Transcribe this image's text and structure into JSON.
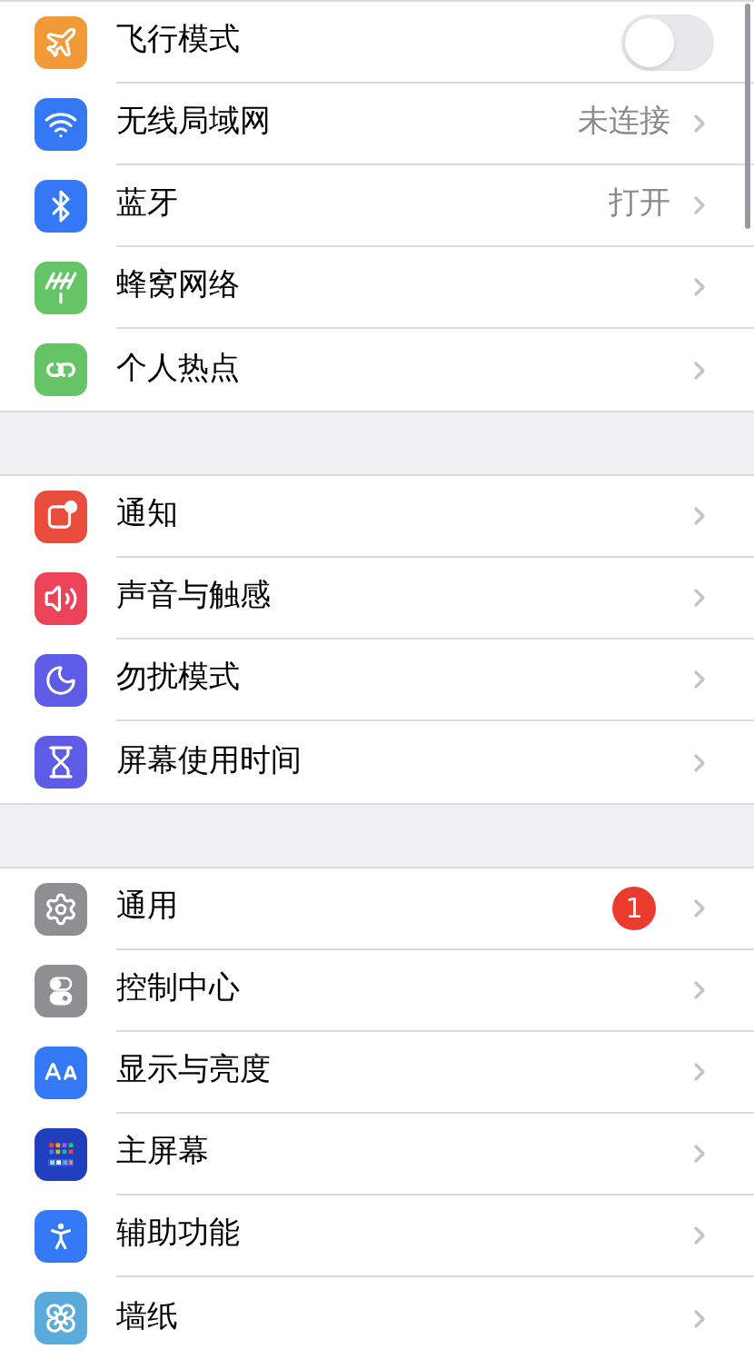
{
  "groups": [
    {
      "items": [
        {
          "label": "飞行模式",
          "kind": "toggle",
          "on": false
        },
        {
          "label": "无线局域网",
          "kind": "link",
          "value": "未连接"
        },
        {
          "label": "蓝牙",
          "kind": "link",
          "value": "打开"
        },
        {
          "label": "蜂窝网络",
          "kind": "link"
        },
        {
          "label": "个人热点",
          "kind": "link"
        }
      ]
    },
    {
      "items": [
        {
          "label": "通知",
          "kind": "link"
        },
        {
          "label": "声音与触感",
          "kind": "link"
        },
        {
          "label": "勿扰模式",
          "kind": "link"
        },
        {
          "label": "屏幕使用时间",
          "kind": "link"
        }
      ]
    },
    {
      "items": [
        {
          "label": "通用",
          "kind": "link",
          "badge": "1"
        },
        {
          "label": "控制中心",
          "kind": "link"
        },
        {
          "label": "显示与亮度",
          "kind": "link"
        },
        {
          "label": "主屏幕",
          "kind": "link"
        },
        {
          "label": "辅助功能",
          "kind": "link"
        },
        {
          "label": "墙纸",
          "kind": "link"
        }
      ]
    }
  ]
}
